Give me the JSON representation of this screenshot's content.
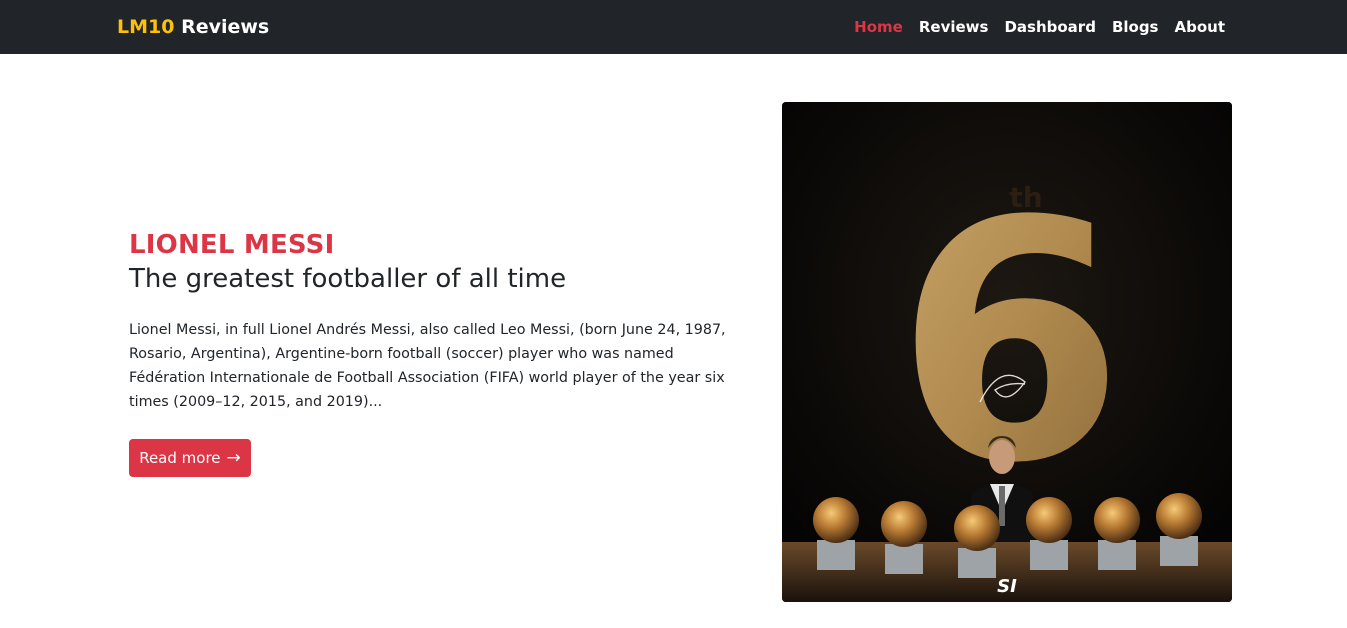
{
  "nav": {
    "brand_accent": "LM10",
    "brand_rest": " Reviews",
    "links": [
      {
        "label": "Home",
        "active": true
      },
      {
        "label": "Reviews",
        "active": false
      },
      {
        "label": "Dashboard",
        "active": false
      },
      {
        "label": "Blogs",
        "active": false
      },
      {
        "label": "About",
        "active": false
      }
    ]
  },
  "hero": {
    "kicker": "LIONEL MESSI",
    "headline": "The greatest footballer of all time",
    "lead": "Lionel Messi, in full Lionel Andrés Messi, also called Leo Messi, (born June 24, 1987, Rosario, Argentina), Argentine-born football (soccer) player who was named Fédération Internationale de Football Association (FIFA) world player of the year six times (2009–12, 2015, and 2019)...",
    "button_label": "Read more",
    "button_icon": "arrow-right-icon",
    "image": {
      "numeral": "6",
      "suffix": "th",
      "watermark": "SI"
    }
  },
  "colors": {
    "navbar_bg": "#212529",
    "brand_accent": "#ffc107",
    "active_link": "#dc3545",
    "button_bg": "#dc3545",
    "text": "#212529"
  }
}
